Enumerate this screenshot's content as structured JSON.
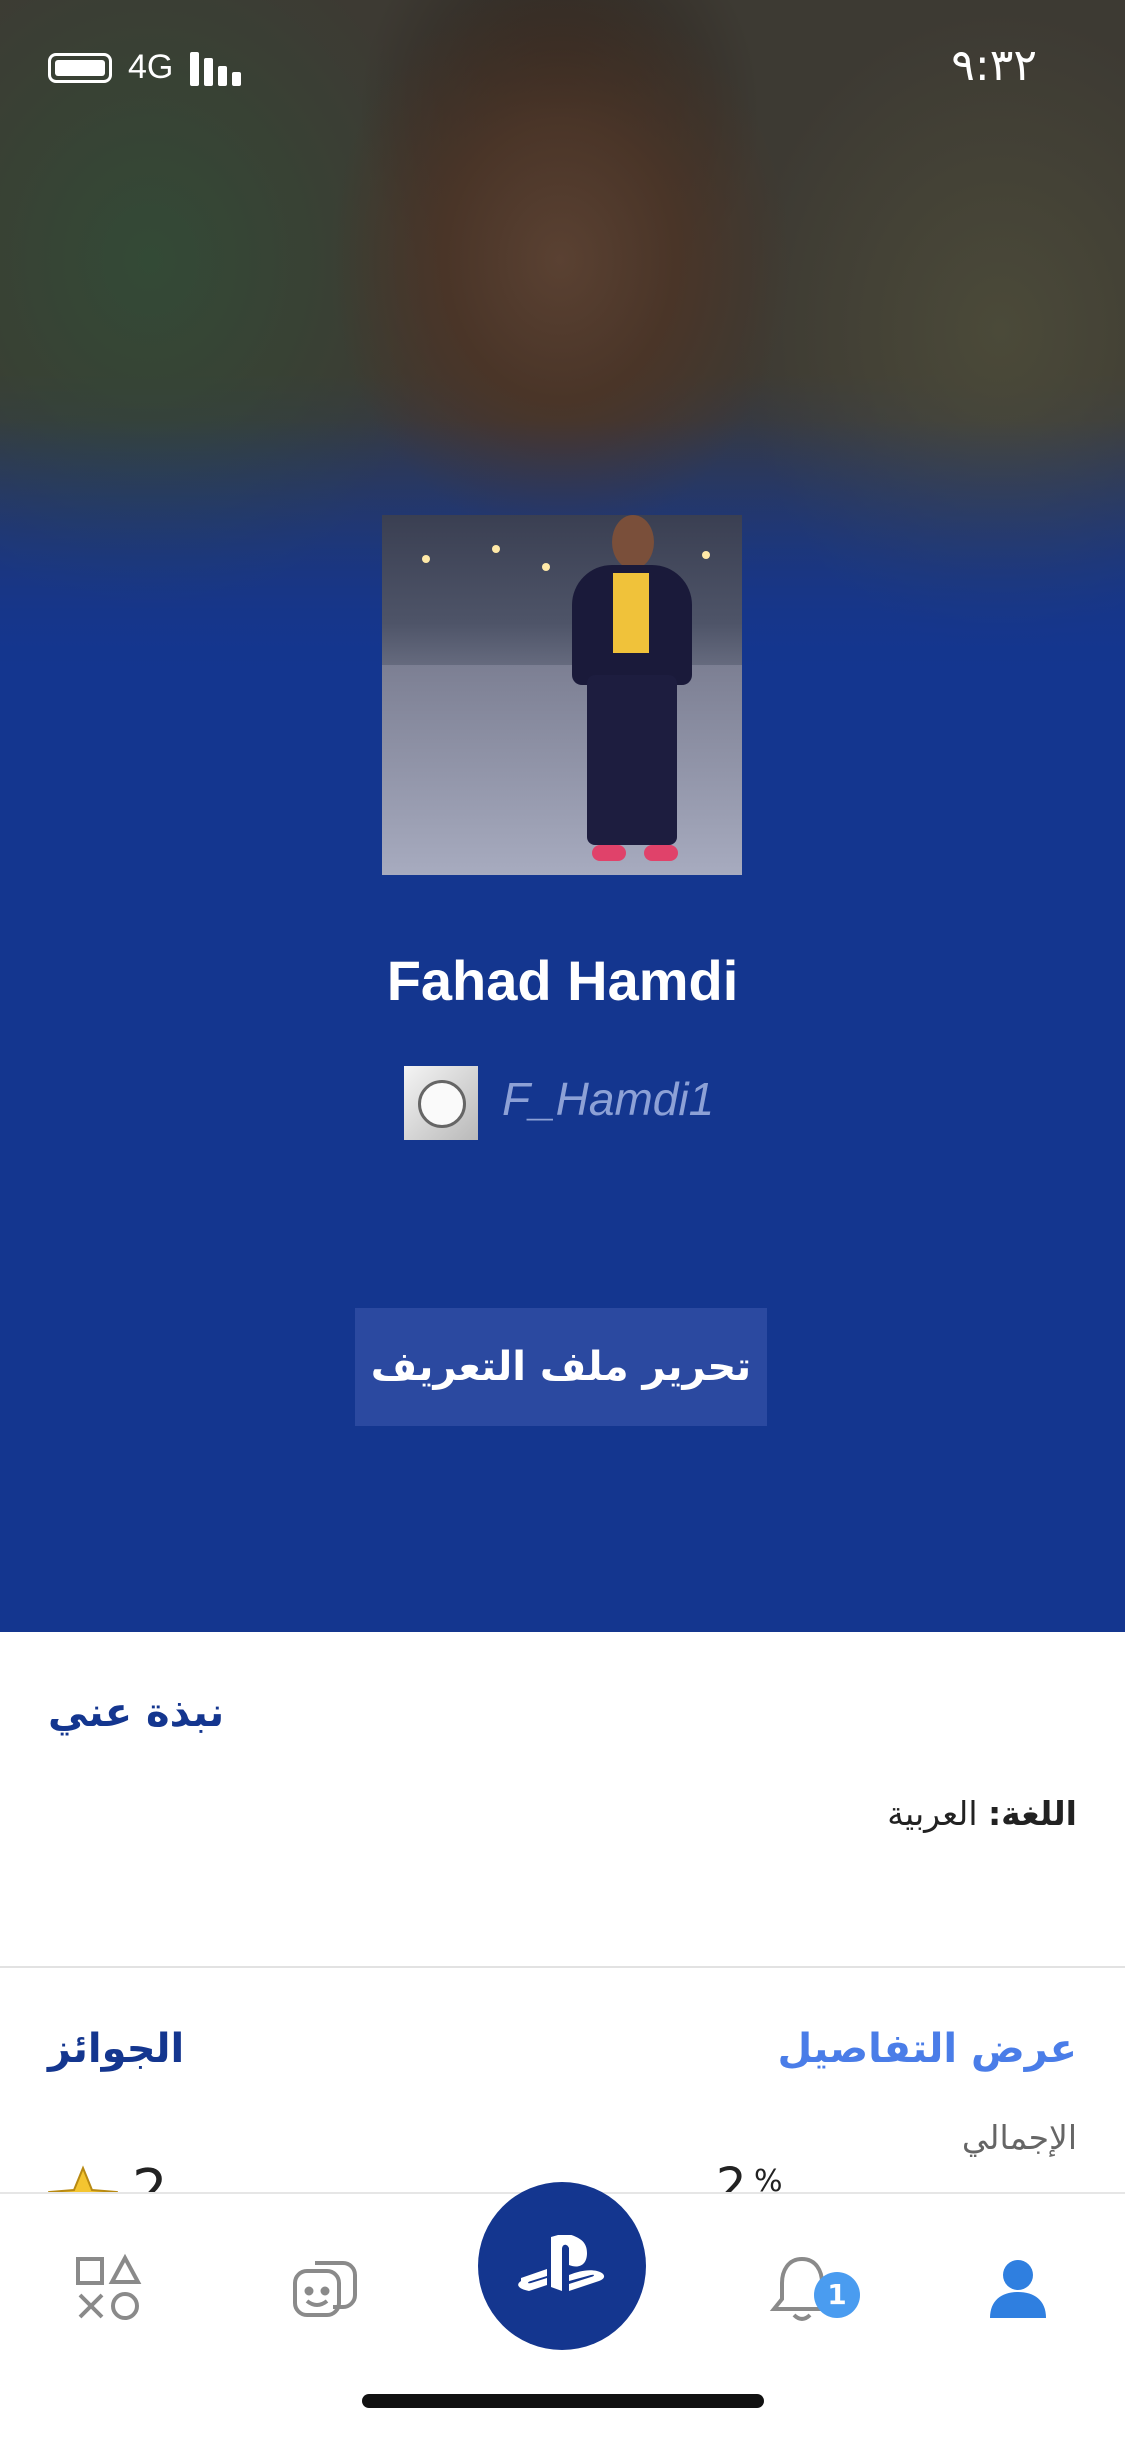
{
  "status_bar": {
    "network": "4G",
    "time": "٩:٣٢"
  },
  "profile": {
    "display_name": "Fahad Hamdi",
    "online_id": "F_Hamdi1",
    "edit_button_label": "تحرير ملف التعريف"
  },
  "about": {
    "title": "نبذة عني",
    "language_label": "اللغة:",
    "language_value": "العربية"
  },
  "trophies": {
    "title": "الجوائز",
    "view_details": "عرض التفاصيل",
    "total_label": "الإجمالي",
    "total_value": "",
    "percent": "2",
    "percent_sign": "%",
    "level": "2"
  },
  "tab_bar": {
    "notifications_badge": "1",
    "items": [
      "games-icon",
      "friends-icon",
      "playstation-icon",
      "notifications-icon",
      "profile-icon"
    ]
  },
  "colors": {
    "primary": "#14368f",
    "accent": "#4a7de8",
    "badge": "#4a9cf0"
  }
}
